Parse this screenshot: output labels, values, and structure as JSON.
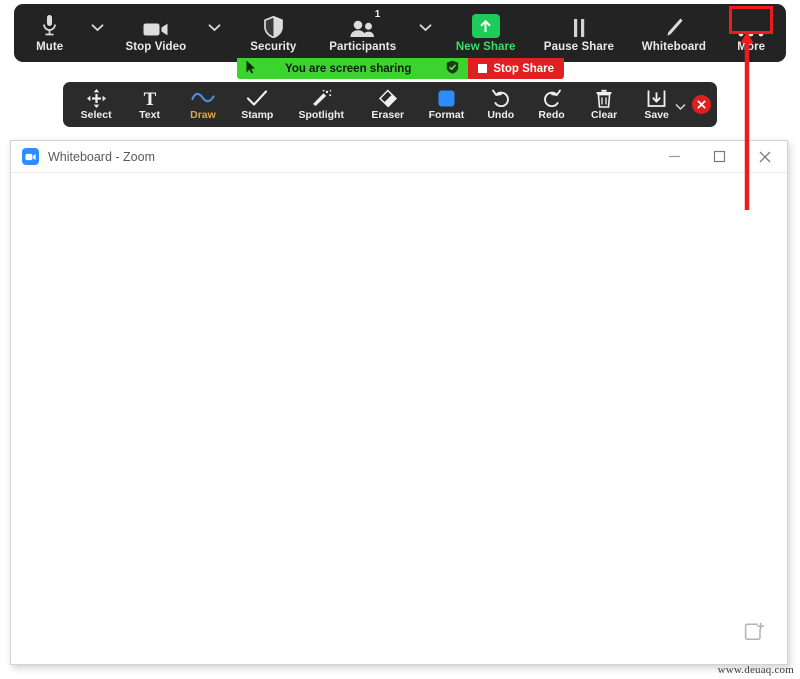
{
  "meeting_toolbar": {
    "items": [
      {
        "label": "Mute",
        "icon": "microphone-icon",
        "has_caret": true,
        "accent": false
      },
      {
        "label": "Stop Video",
        "icon": "video-camera-icon",
        "has_caret": true,
        "accent": false
      },
      {
        "label": "Security",
        "icon": "shield-icon",
        "has_caret": false,
        "accent": false
      },
      {
        "label": "Participants",
        "icon": "participants-icon",
        "has_caret": true,
        "accent": false,
        "badge": "1"
      },
      {
        "label": "New Share",
        "icon": "share-screen-up-arrow-icon",
        "has_caret": false,
        "accent": true
      },
      {
        "label": "Pause Share",
        "icon": "pause-icon",
        "has_caret": false,
        "accent": false
      },
      {
        "label": "Whiteboard",
        "icon": "pencil-icon",
        "has_caret": false,
        "accent": false
      },
      {
        "label": "More",
        "icon": "ellipsis-icon",
        "has_caret": false,
        "accent": false
      }
    ]
  },
  "share_strip": {
    "status_text": "You are screen sharing",
    "stop_label": "Stop Share",
    "green": "#3bd32d",
    "red": "#e02020"
  },
  "annotation_toolbar": {
    "items": [
      {
        "label": "Select",
        "icon": "move-arrows-icon",
        "active": false
      },
      {
        "label": "Text",
        "icon": "text-t-icon",
        "active": false
      },
      {
        "label": "Draw",
        "icon": "squiggle-draw-icon",
        "active": true
      },
      {
        "label": "Stamp",
        "icon": "checkmark-stamp-icon",
        "active": false
      },
      {
        "label": "Spotlight",
        "icon": "spotlight-wand-icon",
        "active": false
      },
      {
        "label": "Eraser",
        "icon": "eraser-icon",
        "active": false
      },
      {
        "label": "Format",
        "icon": "color-swatch-icon",
        "active": false
      },
      {
        "label": "Undo",
        "icon": "undo-arrow-icon",
        "active": false
      },
      {
        "label": "Redo",
        "icon": "redo-arrow-icon",
        "active": false
      },
      {
        "label": "Clear",
        "icon": "trash-can-icon",
        "active": false
      },
      {
        "label": "Save",
        "icon": "save-download-icon",
        "active": false,
        "has_caret": true
      }
    ],
    "close_label": "",
    "active_color": "#e8a33d"
  },
  "whiteboard_window": {
    "title": "Whiteboard - Zoom",
    "app_icon": "zoom-camera-icon",
    "controls": {
      "minimize": "minimize-icon",
      "maximize": "maximize-icon",
      "close": "close-icon"
    },
    "canvas_corner_icon": "new-page-plus-icon"
  },
  "annotation_overlay": {
    "highlight_target": "More",
    "highlight_color": "#ee1c1c",
    "arrow_color": "#ee1c1c"
  },
  "watermark": {
    "text": "www.deuaq.com"
  }
}
